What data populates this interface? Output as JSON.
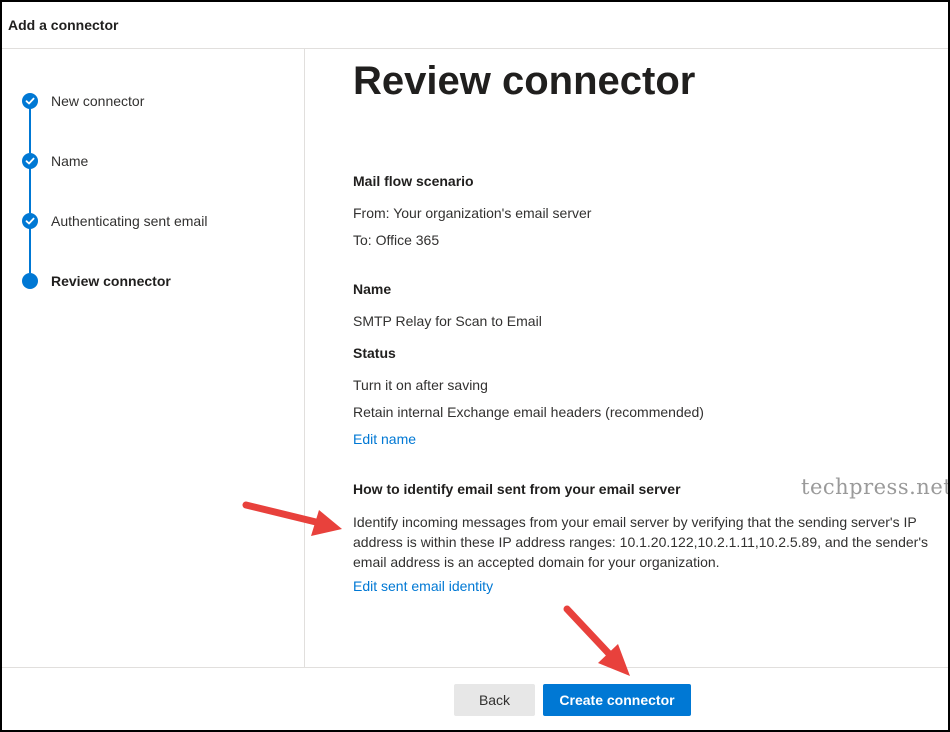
{
  "window": {
    "title": "Add a connector"
  },
  "wizard": {
    "steps": [
      {
        "label": "New connector",
        "state": "completed"
      },
      {
        "label": "Name",
        "state": "completed"
      },
      {
        "label": "Authenticating sent email",
        "state": "completed"
      },
      {
        "label": "Review connector",
        "state": "current"
      }
    ]
  },
  "main": {
    "heading": "Review connector",
    "mail_flow": {
      "title": "Mail flow scenario",
      "from": "From: Your organization's email server",
      "to": "To: Office 365"
    },
    "name_section": {
      "title": "Name",
      "value": "SMTP Relay for Scan to Email"
    },
    "status_section": {
      "title": "Status",
      "line1": "Turn it on after saving",
      "line2": "Retain internal Exchange email headers (recommended)",
      "edit_link": "Edit name"
    },
    "identify_section": {
      "title": "How to identify email sent from your email server",
      "description": "Identify incoming messages from your email server by verifying that the sending server's IP address is within these IP address ranges: 10.1.20.122,10.2.1.11,10.2.5.89, and the sender's email address is an accepted domain for your organization.",
      "edit_link": "Edit sent email identity"
    },
    "watermark": "techpress.net"
  },
  "footer": {
    "back_label": "Back",
    "create_label": "Create connector"
  },
  "colors": {
    "accent": "#0078d4",
    "annotation_arrow": "#e8413c"
  },
  "icons": {
    "completed_step": "checkmark-icon",
    "current_step": "filled-circle-icon"
  }
}
